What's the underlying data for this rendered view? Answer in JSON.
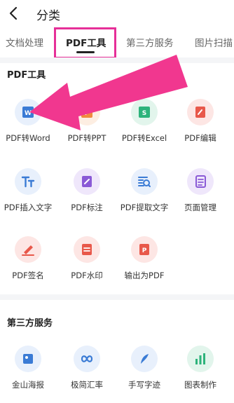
{
  "header": {
    "title": "分类"
  },
  "tabs": [
    {
      "label": "文档处理"
    },
    {
      "label": "PDF工具"
    },
    {
      "label": "第三方服务"
    },
    {
      "label": "图片扫描"
    }
  ],
  "sections": [
    {
      "title": "PDF工具",
      "items": [
        {
          "label": "PDF转Word",
          "icon": "pdf-to-word-icon"
        },
        {
          "label": "PDF转PPT",
          "icon": "pdf-to-ppt-icon"
        },
        {
          "label": "PDF转Excel",
          "icon": "pdf-to-excel-icon"
        },
        {
          "label": "PDF编辑",
          "icon": "pdf-edit-icon"
        },
        {
          "label": "PDF插入文字",
          "icon": "insert-text-icon"
        },
        {
          "label": "PDF标注",
          "icon": "annotate-icon"
        },
        {
          "label": "PDF提取文字",
          "icon": "extract-text-icon"
        },
        {
          "label": "页面管理",
          "icon": "page-manage-icon"
        },
        {
          "label": "PDF签名",
          "icon": "signature-icon"
        },
        {
          "label": "PDF水印",
          "icon": "watermark-icon"
        },
        {
          "label": "输出为PDF",
          "icon": "export-pdf-icon"
        }
      ]
    },
    {
      "title": "第三方服务",
      "items": [
        {
          "label": "金山海报",
          "icon": "poster-icon"
        },
        {
          "label": "极简汇率",
          "icon": "exchange-rate-icon"
        },
        {
          "label": "手写字迹",
          "icon": "handwriting-icon"
        },
        {
          "label": "图表制作",
          "icon": "chart-maker-icon"
        }
      ]
    }
  ],
  "colors": {
    "highlight": "#e62f98",
    "blue": "#3a7bd5",
    "orange": "#f08a3e",
    "green": "#2db37b",
    "red": "#e8584a",
    "purple": "#8a5ad6"
  }
}
